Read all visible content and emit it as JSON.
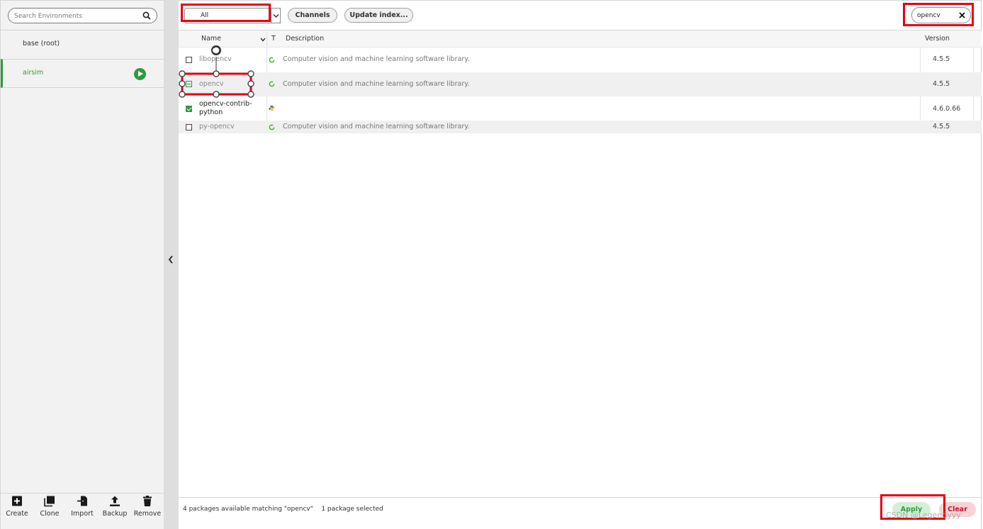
{
  "environments": {
    "search_placeholder": "Search Environments",
    "items": [
      {
        "label": "base (root)",
        "active": false
      },
      {
        "label": "airsim",
        "active": true
      }
    ],
    "actions": [
      {
        "label": "Create",
        "icon": "plus-square-icon"
      },
      {
        "label": "Clone",
        "icon": "clone-icon"
      },
      {
        "label": "Import",
        "icon": "import-icon"
      },
      {
        "label": "Backup",
        "icon": "upload-icon"
      },
      {
        "label": "Remove",
        "icon": "trash-icon"
      }
    ]
  },
  "toolbar": {
    "filter_value": "All",
    "channels_label": "Channels",
    "update_index_label": "Update index...",
    "search_value": "opencv"
  },
  "table": {
    "headers": {
      "name": "Name",
      "type": "T",
      "description": "Description",
      "version": "Version"
    },
    "rows": [
      {
        "name": "libopencv",
        "description": "Computer vision and machine learning software library.",
        "version": "4.5.5",
        "state": "unchecked",
        "type_icon": "conda-ring-icon"
      },
      {
        "name": "opencv",
        "description": "Computer vision and machine learning software library.",
        "version": "4.5.5",
        "state": "upgrade",
        "type_icon": "conda-ring-icon"
      },
      {
        "name": "opencv-contrib-python",
        "description": "",
        "version": "4.6.0.66",
        "state": "checked",
        "type_icon": "python-icon"
      },
      {
        "name": "py-opencv",
        "description": "Computer vision and machine learning software library.",
        "version": "4.5.5",
        "state": "unchecked",
        "type_icon": "conda-ring-icon"
      }
    ]
  },
  "status": {
    "text": "4 packages available matching \"opencv\"    1 package selected",
    "apply_label": "Apply",
    "clear_label": "Clear"
  },
  "watermark": "CSDN @Legendyyy",
  "colors": {
    "accent": "#2e9b3f",
    "highlight": "#e60012",
    "danger": "#c8102e"
  }
}
